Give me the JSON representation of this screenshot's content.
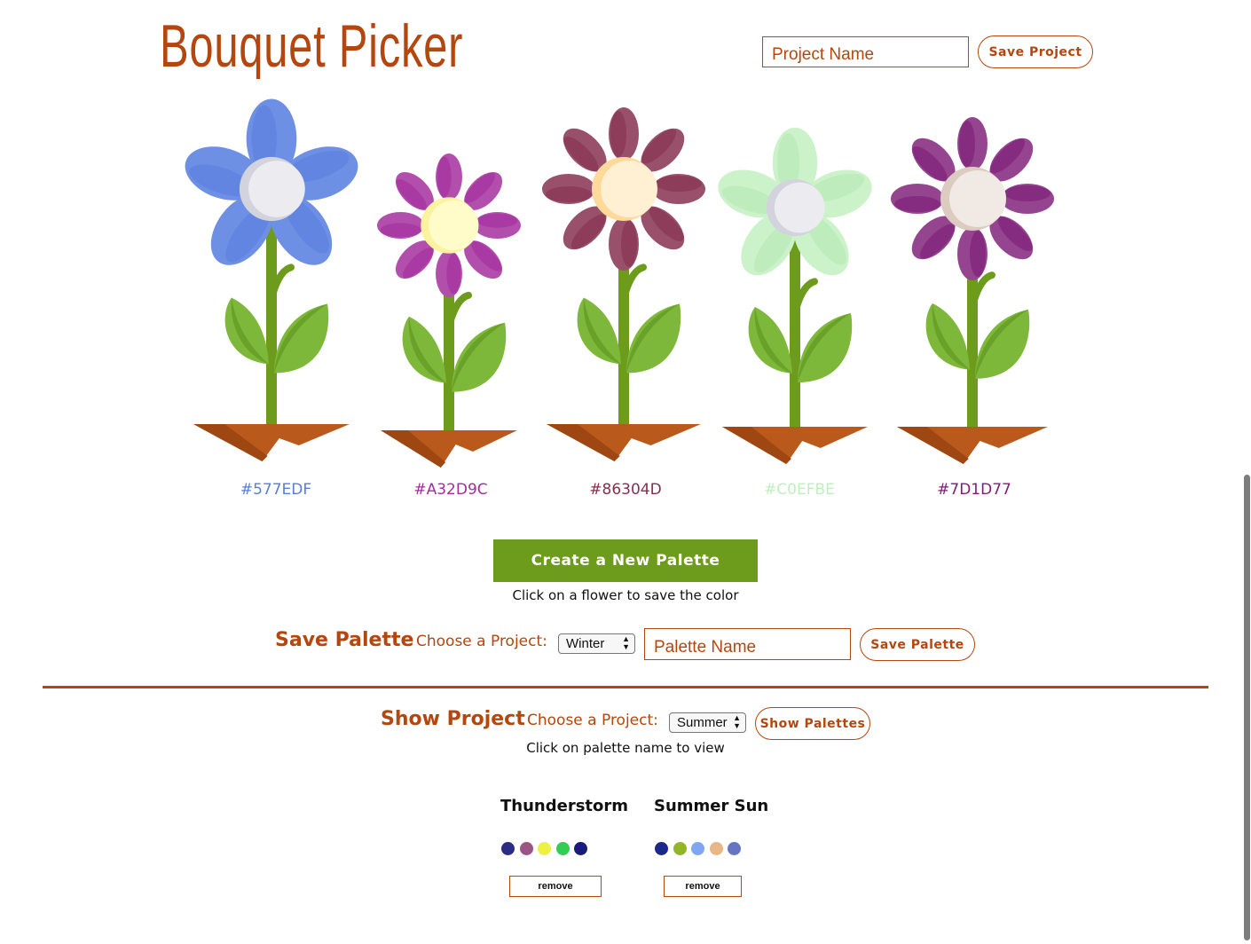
{
  "header": {
    "title": "Bouquet Picker",
    "project_name_placeholder": "Project Name",
    "save_project_label": "Save Project"
  },
  "flowers": [
    {
      "hex": "#577EDF",
      "petal": "#6d8fe4",
      "petal_dark": "#577EDF",
      "center": "#ebebf0",
      "center_shade": "#d3d3de",
      "style": "five"
    },
    {
      "hex": "#A32D9C",
      "petal": "#b24fac",
      "petal_dark": "#A32D9C",
      "center": "#fffcc9",
      "center_shade": "#fbf3a0",
      "style": "eight"
    },
    {
      "hex": "#86304D",
      "petal": "#99506b",
      "petal_dark": "#86304D",
      "center": "#fff0d3",
      "center_shade": "#fdd99a",
      "style": "eight"
    },
    {
      "hex": "#C0EFBE",
      "petal": "#ccf2ca",
      "petal_dark": "#b3e8b0",
      "center": "#ebebf0",
      "center_shade": "#d3d3de",
      "style": "five"
    },
    {
      "hex": "#7D1D77",
      "petal": "#95458f",
      "petal_dark": "#7D1D77",
      "center": "#f0e9e4",
      "center_shade": "#dccbc0",
      "style": "eight"
    }
  ],
  "create": {
    "button_label": "Create a New Palette",
    "hint": "Click on a flower to save the color"
  },
  "save_palette": {
    "heading": "Save Palette",
    "choose_label": "Choose a Project:",
    "selected_project": "Winter",
    "palette_name_placeholder": "Palette Name",
    "button_label": "Save Palette"
  },
  "show_project": {
    "heading": "Show Project",
    "choose_label": "Choose a Project:",
    "selected_project": "Summer",
    "button_label": "Show Palettes",
    "hint": "Click on palette name to view"
  },
  "palettes": [
    {
      "name": "Thunderstorm",
      "colors": [
        "#2c2c85",
        "#9b5585",
        "#eef042",
        "#33cc55",
        "#1b1b7d"
      ],
      "remove_label": "remove"
    },
    {
      "name": "Summer Sun",
      "colors": [
        "#1b2a8a",
        "#92b529",
        "#80a6f2",
        "#e8b788",
        "#6774c4"
      ],
      "remove_label": "remove"
    }
  ],
  "colors": {
    "accent": "#b4470f",
    "create_button": "#6d9c1d",
    "stem": "#6d9c1d",
    "leaf": "#7db83a",
    "leaf_dark": "#6aa129",
    "pot": "#b95a1c",
    "pot_dark": "#9e4712"
  }
}
